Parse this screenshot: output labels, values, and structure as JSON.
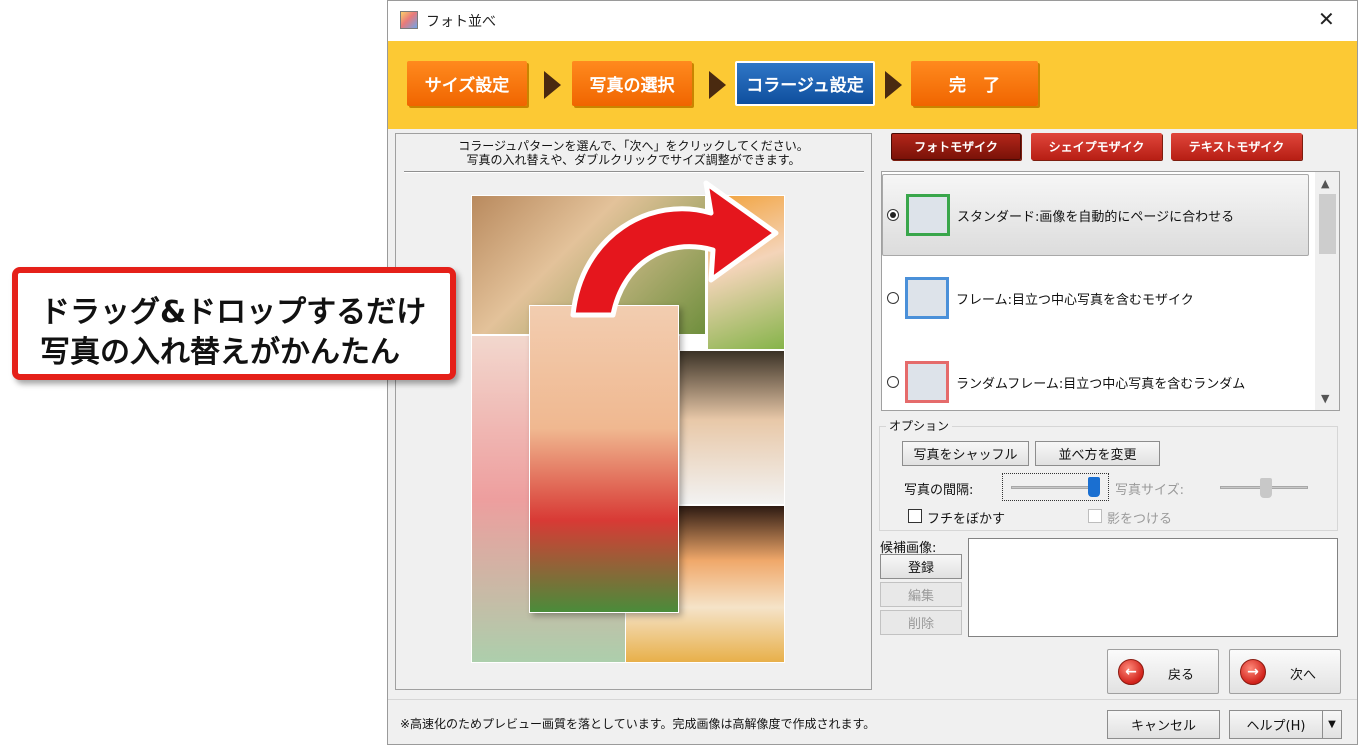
{
  "window": {
    "title": "フォト並べ",
    "close_glyph": "✕"
  },
  "steps": [
    {
      "label": "サイズ設定",
      "state": "done"
    },
    {
      "label": "写真の選択",
      "state": "done"
    },
    {
      "label": "コラージュ設定",
      "state": "active"
    },
    {
      "label": "完　了",
      "state": "pending"
    }
  ],
  "preview": {
    "instruction_line1": "コラージュパターンを選んで、「次へ」をクリックしてください。",
    "instruction_line2": "写真の入れ替えや、ダブルクリックでサイズ調整ができます。"
  },
  "mosaic_tabs": [
    {
      "label": "フォトモザイク",
      "selected": true
    },
    {
      "label": "シェイプモザイク",
      "selected": false
    },
    {
      "label": "テキストモザイク",
      "selected": false
    }
  ],
  "patterns": [
    {
      "label": "スタンダード:画像を自動的にページに合わせる",
      "selected": true,
      "color": "#39a64b"
    },
    {
      "label": "フレーム:目立つ中心写真を含むモザイク",
      "selected": false,
      "color": "#4a90d9"
    },
    {
      "label": "ランダムフレーム:目立つ中心写真を含むランダム",
      "selected": false,
      "color": "#e56b6b"
    }
  ],
  "options": {
    "group_label": "オプション",
    "shuffle_button": "写真をシャッフル",
    "reorder_button": "並べ方を変更",
    "spacing_label": "写真の間隔:",
    "photo_size_label": "写真サイズ:",
    "blur_edge_label": "フチをぼかす",
    "shadow_label": "影をつける"
  },
  "candidates": {
    "label": "候補画像:",
    "register_button": "登録",
    "edit_button": "編集",
    "delete_button": "削除"
  },
  "nav": {
    "back_label": "戻る",
    "next_label": "次へ"
  },
  "footer": {
    "status_text": "※高速化のためプレビュー画質を落としています。完成画像は高解像度で作成されます。",
    "cancel_button": "キャンセル",
    "help_button": "ヘルプ(H)"
  },
  "callout": {
    "line1": "ドラッグ&ドロップするだけ",
    "line2": "写真の入れ替えがかんたん"
  },
  "colors": {
    "banner": "#fcc934",
    "step_orange": "#f57a10",
    "step_blue": "#1a5eae",
    "tab_red": "#d2352a",
    "callout_border": "#e52019",
    "knob_blue": "#1a6fd1"
  }
}
